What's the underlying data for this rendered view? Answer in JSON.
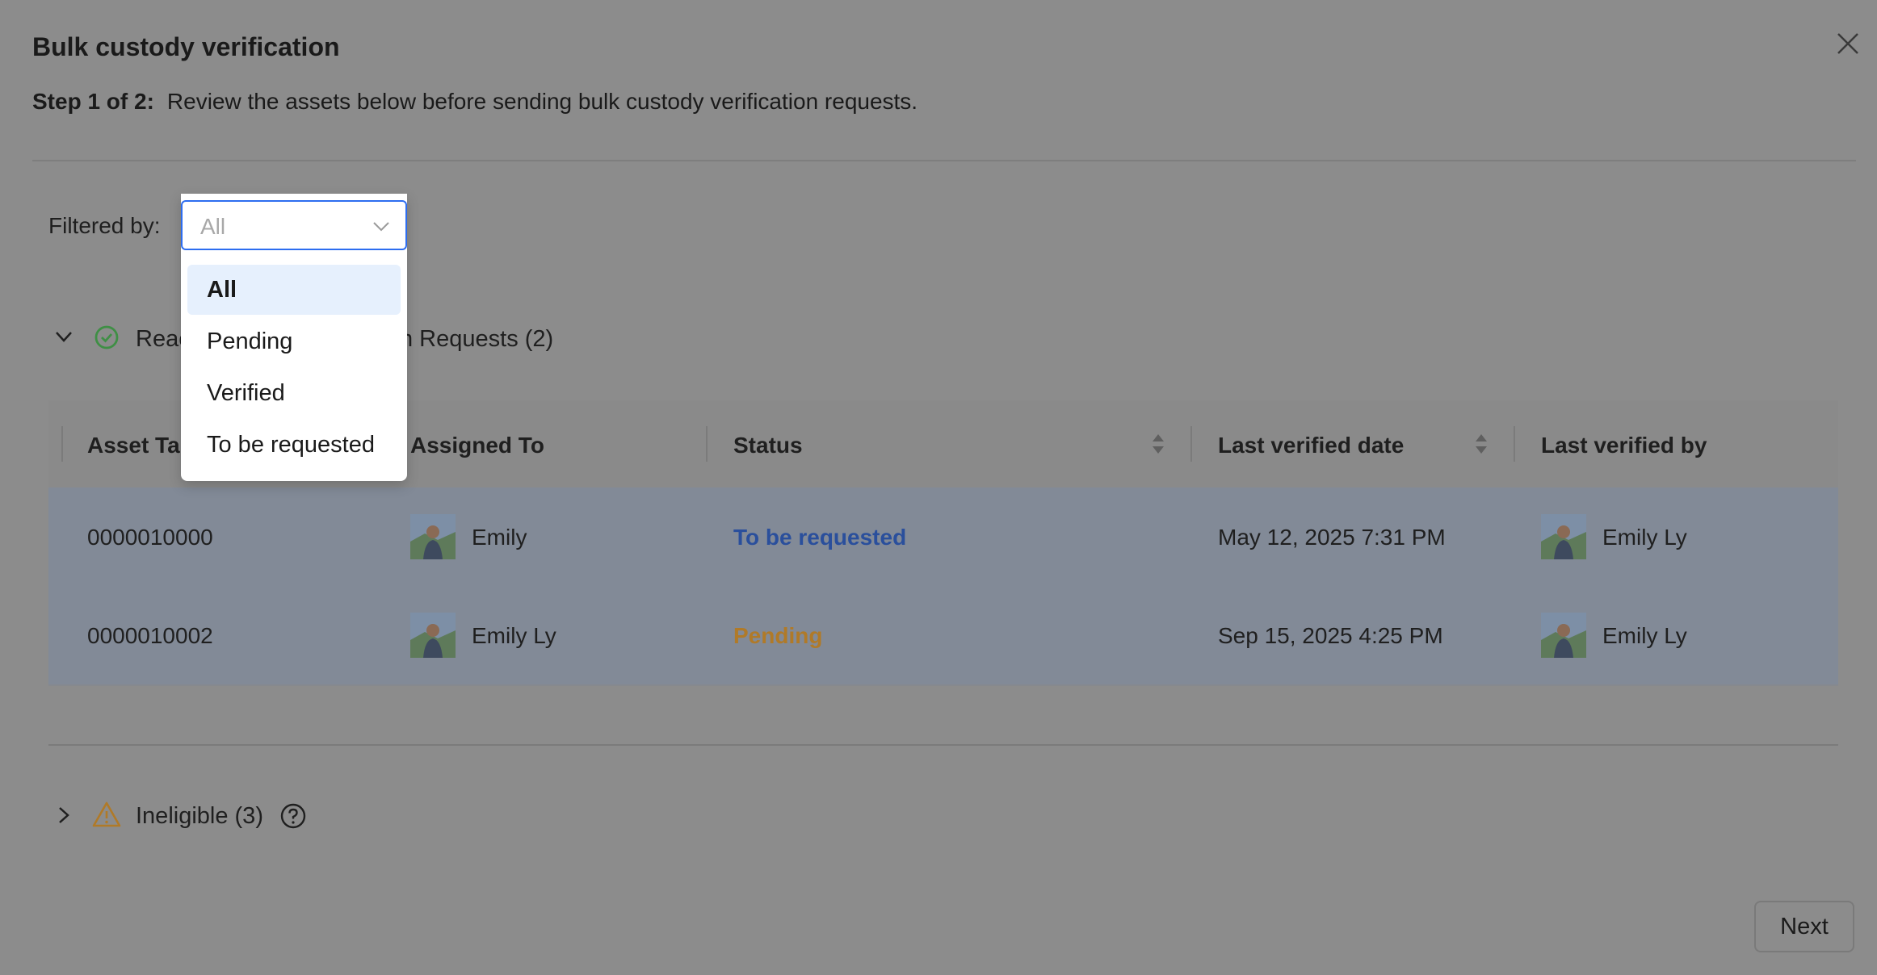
{
  "dialog": {
    "title": "Bulk custody verification",
    "step_prefix": "Step 1 of 2:",
    "step_text": "Review the assets below before sending bulk custody verification requests."
  },
  "filter": {
    "label": "Filtered by:",
    "selected": "All",
    "options": [
      "All",
      "Pending",
      "Verified",
      "To be requested"
    ]
  },
  "ready_section": {
    "label_visible_left": "Reac",
    "label_visible_right": "n Requests (2)"
  },
  "table": {
    "columns": [
      "Asset Ta",
      "Assigned To",
      "Status",
      "Last verified date",
      "Last verified by"
    ],
    "rows": [
      {
        "asset_tag": "0000010000",
        "assigned_to": "Emily",
        "status": "To be requested",
        "last_verified_date": "May 12, 2025 7:31 PM",
        "last_verified_by": "Emily Ly"
      },
      {
        "asset_tag": "0000010002",
        "assigned_to": "Emily Ly",
        "status": "Pending",
        "last_verified_date": "Sep 15, 2025 4:25 PM",
        "last_verified_by": "Emily Ly"
      }
    ]
  },
  "ineligible": {
    "label": "Ineligible (3)"
  },
  "footer": {
    "next_label": "Next"
  },
  "colors": {
    "accent": "#2d6df0",
    "status_to_be_requested": "#2a4f9c",
    "status_pending": "#b07a28",
    "check_green": "#3f8f45",
    "warning_orange": "#b07a28"
  },
  "icons": [
    "close-icon",
    "chevron-down-icon",
    "check-circle-icon",
    "sort-icon",
    "chevron-right-icon",
    "warning-icon",
    "help-circle-icon"
  ]
}
